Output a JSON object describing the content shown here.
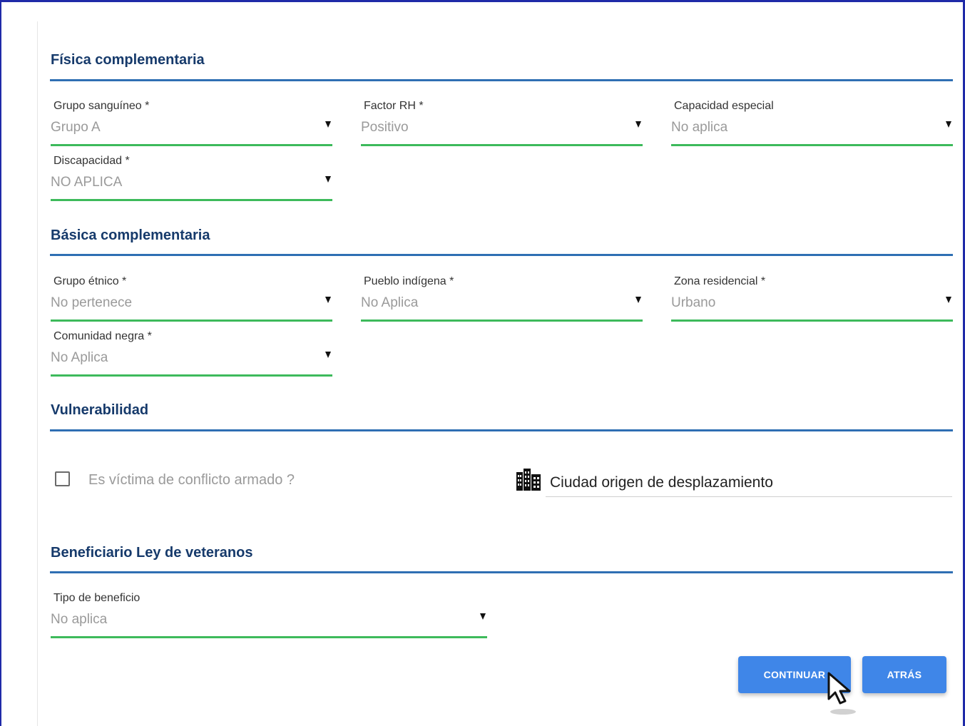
{
  "sections": {
    "fisica": {
      "title": "Física complementaria"
    },
    "basica": {
      "title": "Básica complementaria"
    },
    "vulnerabilidad": {
      "title": "Vulnerabilidad"
    },
    "beneficiario": {
      "title": "Beneficiario Ley de veteranos"
    }
  },
  "fields": {
    "grupo_sanguineo": {
      "label": "Grupo sanguíneo *",
      "value": "Grupo A"
    },
    "factor_rh": {
      "label": "Factor RH *",
      "value": "Positivo"
    },
    "capacidad_especial": {
      "label": "Capacidad especial",
      "value": "No aplica"
    },
    "discapacidad": {
      "label": "Discapacidad *",
      "value": "NO APLICA"
    },
    "grupo_etnico": {
      "label": "Grupo étnico *",
      "value": "No pertenece"
    },
    "pueblo_indigena": {
      "label": "Pueblo indígena *",
      "value": "No Aplica"
    },
    "zona_residencial": {
      "label": "Zona residencial *",
      "value": "Urbano"
    },
    "comunidad_negra": {
      "label": "Comunidad negra *",
      "value": "No Aplica"
    },
    "tipo_beneficio": {
      "label": "Tipo de beneficio",
      "value": "No aplica"
    }
  },
  "vulnerabilidad": {
    "victima_label": "Es víctima de conflicto armado ?",
    "victima_checked": false,
    "ciudad_origen": "Ciudad origen de desplazamiento"
  },
  "actions": {
    "continue_label": "CONTINUAR",
    "back_label": "ATRÁS"
  },
  "colors": {
    "accent": "#3f86e8",
    "section_rule": "#2f6fb3",
    "field_underline": "#3dba5b",
    "title": "#163a6b"
  },
  "icons": {
    "select_caret": "caret-down-icon",
    "city": "city-icon",
    "cursor": "mouse-pointer-icon"
  }
}
